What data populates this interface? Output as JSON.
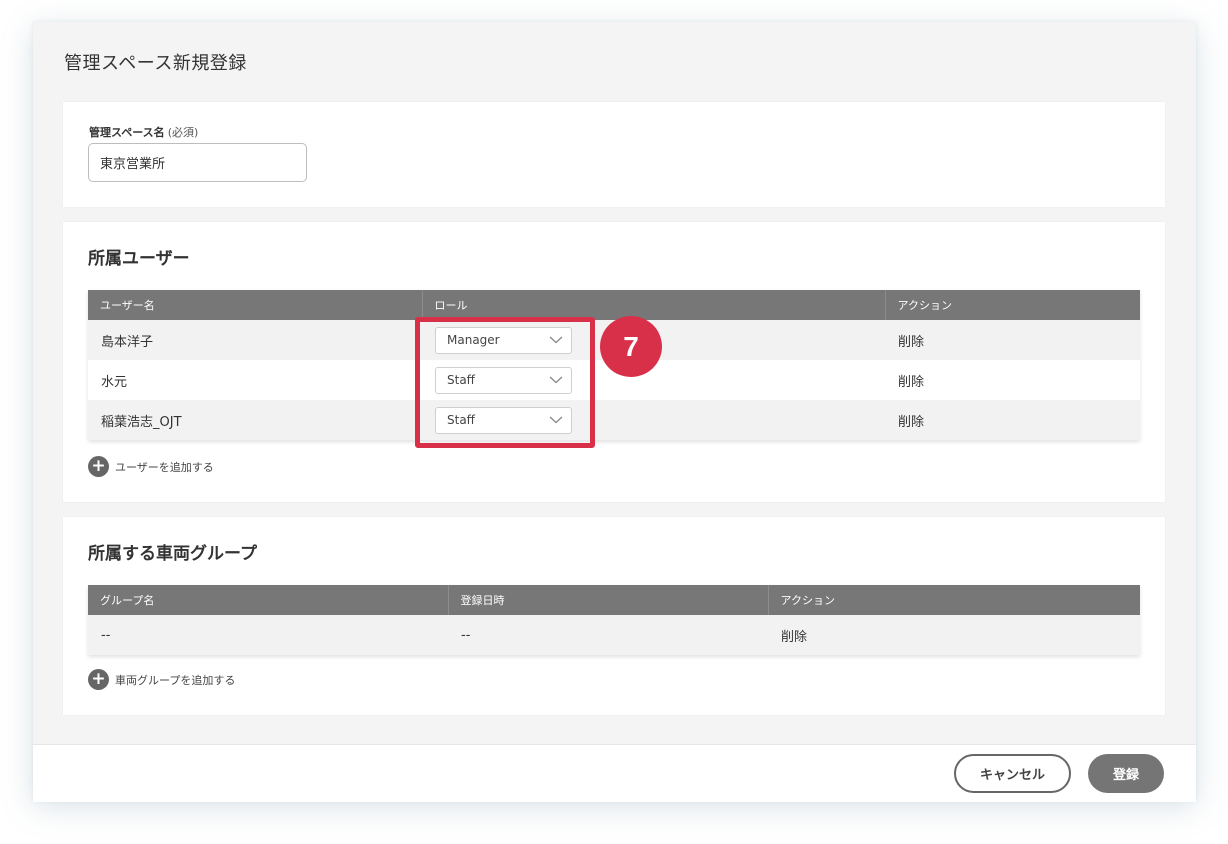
{
  "header": {
    "title": "管理スペース新規登録"
  },
  "basic": {
    "name_label": "管理スペース名",
    "required_note": "(必須)",
    "name_value": "東京営業所"
  },
  "users": {
    "title": "所属ユーザー",
    "columns": [
      "ユーザー名",
      "ロール",
      "アクション"
    ],
    "rows": [
      {
        "name": "島本洋子",
        "role": "Manager",
        "action": "削除"
      },
      {
        "name": "水元",
        "role": "Staff",
        "action": "削除"
      },
      {
        "name": "稲葉浩志_OJT",
        "role": "Staff",
        "action": "削除"
      }
    ],
    "add_label": "ユーザーを追加する"
  },
  "groups": {
    "title": "所属する車両グループ",
    "columns": [
      "グループ名",
      "登録日時",
      "アクション"
    ],
    "rows": [
      {
        "name": "--",
        "date": "--",
        "action": "削除"
      }
    ],
    "add_label": "車両グループを追加する"
  },
  "footer": {
    "cancel_label": "キャンセル",
    "submit_label": "登録"
  },
  "annotation": {
    "step_number": "7",
    "color": "#d9304a"
  },
  "colors": {
    "header_bg": "#777777",
    "button_bg": "#757575"
  },
  "icons": {
    "dropdown": "chevron-down-icon",
    "add": "plus-circle-icon"
  }
}
